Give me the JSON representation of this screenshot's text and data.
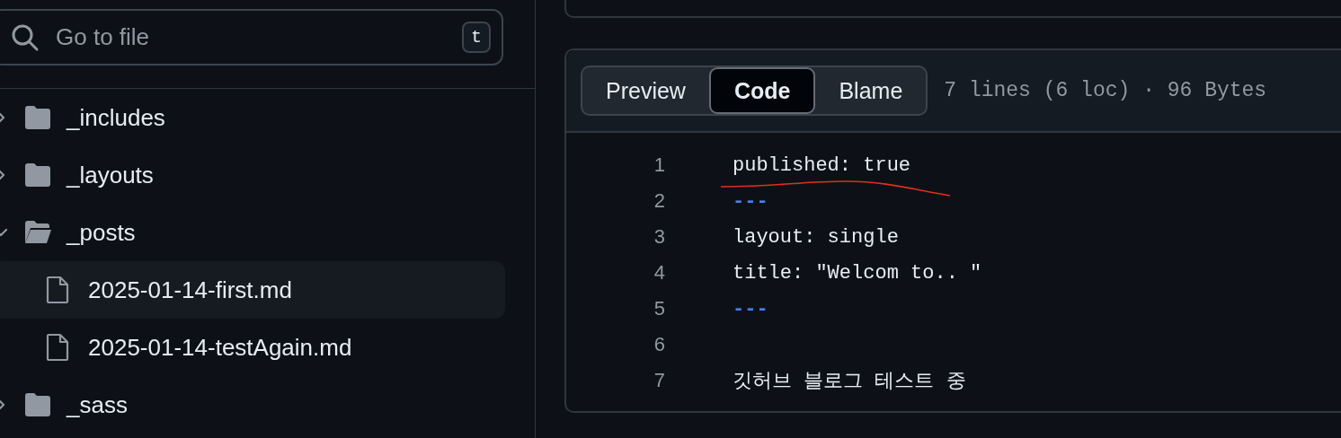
{
  "file_search": {
    "placeholder": "Go to file",
    "shortcut": "t"
  },
  "file_tree": [
    {
      "name": "_includes",
      "kind": "folder",
      "expanded": false
    },
    {
      "name": "_layouts",
      "kind": "folder",
      "expanded": false
    },
    {
      "name": "_posts",
      "kind": "folder",
      "expanded": true,
      "children": [
        {
          "name": "2025-01-14-first.md",
          "kind": "file",
          "selected": true
        },
        {
          "name": "2025-01-14-testAgain.md",
          "kind": "file",
          "selected": false
        }
      ]
    },
    {
      "name": "_sass",
      "kind": "folder",
      "expanded": false
    }
  ],
  "view_tabs": [
    {
      "label": "Preview",
      "selected": false
    },
    {
      "label": "Code",
      "selected": true
    },
    {
      "label": "Blame",
      "selected": false
    }
  ],
  "file_info": "7 lines (6 loc) · 96 Bytes",
  "code_lines": [
    {
      "number": "1",
      "kind": "text",
      "text": "published: true"
    },
    {
      "number": "2",
      "kind": "delimiter",
      "text": "---"
    },
    {
      "number": "3",
      "kind": "text",
      "text": "layout: single"
    },
    {
      "number": "4",
      "kind": "text",
      "text": "title: \"Welcom to.. \""
    },
    {
      "number": "5",
      "kind": "delimiter",
      "text": "---"
    },
    {
      "number": "6"
    },
    {
      "number": "7",
      "kind": "text",
      "text": "깃허브 블로그 테스트 중"
    }
  ]
}
